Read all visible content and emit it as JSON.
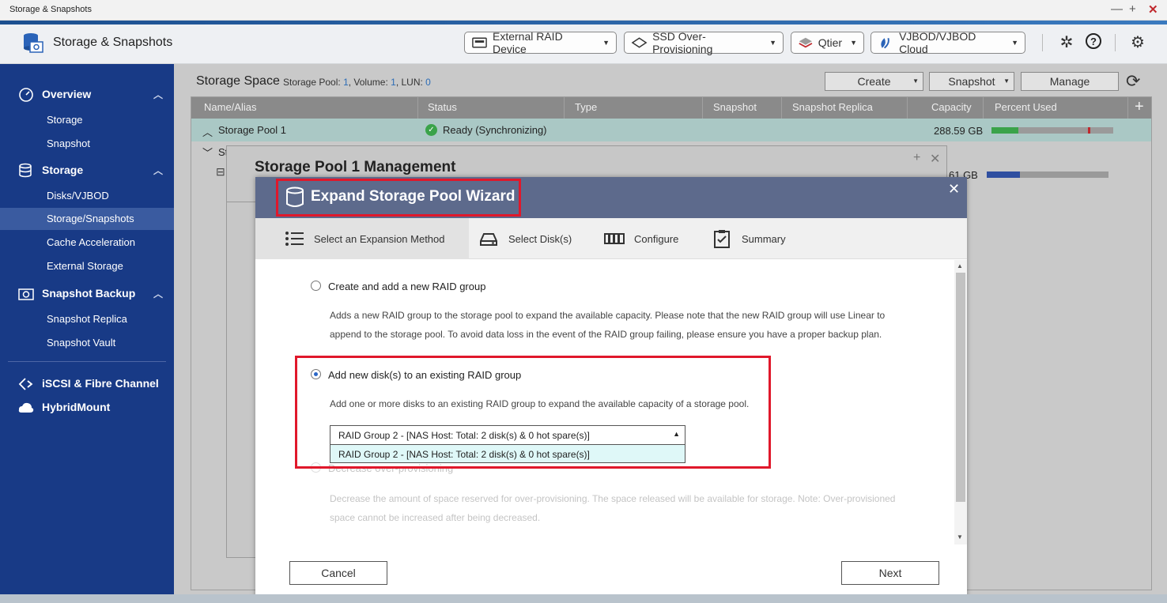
{
  "window": {
    "title": "Storage & Snapshots",
    "controls": [
      "—",
      "+",
      "✕"
    ]
  },
  "app": {
    "name": "Storage & Snapshots",
    "header_buttons": [
      {
        "label": "External RAID Device",
        "icon": "raid-device-icon"
      },
      {
        "label": "SSD Over-Provisioning",
        "icon": "ssd-icon"
      },
      {
        "label": "Qtier",
        "icon": "qtier-icon"
      },
      {
        "label": "VJBOD/VJBOD Cloud",
        "icon": "vjbod-cloud-icon"
      }
    ],
    "header_icons": [
      "wrench-icon",
      "help-icon",
      "gear-icon"
    ],
    "accent_color": "#183a86"
  },
  "sidebar": {
    "groups": [
      {
        "label": "Overview",
        "icon": "overview-gauge-icon",
        "items": [
          "Storage",
          "Snapshot"
        ]
      },
      {
        "label": "Storage",
        "icon": "database-icon",
        "items": [
          "Disks/VJBOD",
          "Storage/Snapshots",
          "Cache Acceleration",
          "External Storage"
        ]
      },
      {
        "label": "Snapshot Backup",
        "icon": "camera-icon",
        "items": [
          "Snapshot Replica",
          "Snapshot Vault"
        ]
      }
    ],
    "extra": [
      {
        "label": "iSCSI & Fibre Channel",
        "icon": "iscsi-icon"
      },
      {
        "label": "HybridMount",
        "icon": "cloud-mount-icon"
      }
    ],
    "active_item": "Storage/Snapshots"
  },
  "storage_space": {
    "title": "Storage Space",
    "meta_prefix": "Storage Pool: ",
    "pool_count": "1",
    "volume_label": ", Volume: ",
    "volume_count": "1",
    "lun_label": ", LUN: ",
    "lun_count": "0",
    "buttons": {
      "create": "Create",
      "snapshot": "Snapshot",
      "manage": "Manage"
    }
  },
  "table": {
    "columns": [
      "Name/Alias",
      "Status",
      "Type",
      "Snapshot",
      "Snapshot Replica",
      "Capacity",
      "Percent Used"
    ],
    "rows": [
      {
        "name": "Storage Pool 1",
        "status": "Ready (Synchronizing)",
        "capacity": "288.59 GB",
        "percent_used": 0.22
      },
      {
        "name": "St",
        "capacity": "61 GB",
        "percent_used": 0.27
      }
    ]
  },
  "management": {
    "title": "Storage Pool 1 Management"
  },
  "wizard": {
    "title": "Expand Storage Pool Wizard",
    "steps": [
      "Select an Expansion Method",
      "Select Disk(s)",
      "Configure",
      "Summary"
    ],
    "options": [
      {
        "label": "Create and add a new RAID group",
        "desc1": "Adds a new RAID group to the storage pool to expand the available capacity. Please note that the new RAID group will use Linear to",
        "desc2": "append to the storage pool. To avoid data loss in the event of the RAID group failing, please ensure you have a proper backup plan."
      },
      {
        "label": "Add new disk(s) to an existing RAID group",
        "desc1": "Add one or more disks to an existing RAID group to expand the available capacity of a storage pool.",
        "select_value": "RAID Group 2 -  [NAS Host: Total: 2 disk(s) & 0 hot spare(s)]",
        "dropdown_option": "RAID Group 2 - [NAS Host: Total: 2 disk(s) & 0 hot spare(s)]"
      },
      {
        "label": "Decrease over-provisioning",
        "desc1": "Decrease the amount of space reserved for over-provisioning. The space released will be available for storage. Note: Over-provisioned",
        "desc2": "space cannot be increased after being decreased."
      }
    ],
    "buttons": {
      "cancel": "Cancel",
      "next": "Next"
    }
  }
}
